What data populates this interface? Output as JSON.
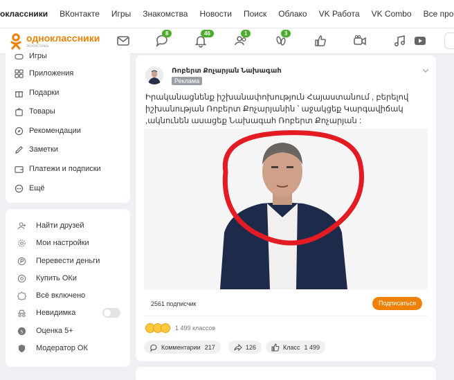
{
  "projects": {
    "items": [
      "оклассники",
      "ВКонтакте",
      "Игры",
      "Знакомства",
      "Новости",
      "Поиск",
      "Облако",
      "VK Работа",
      "VK Combo",
      "Все проекты"
    ]
  },
  "header": {
    "logo_text": "одноклассники",
    "logo_sub": "экосистема",
    "badges": {
      "discussions": "8",
      "notifications": "46",
      "friends": "1",
      "guests": "3"
    }
  },
  "sidebar": {
    "menu1": [
      "Игры",
      "Приложения",
      "Подарки",
      "Товары",
      "Рекомендации",
      "Заметки",
      "Платежи и подписки",
      "Ещё"
    ],
    "menu2": [
      "Найти друзей",
      "Мои настройки",
      "Перевести деньги",
      "Купить ОКи",
      "Всё включено",
      "Невидимка",
      "Оценка 5+",
      "Модератор ОК"
    ]
  },
  "post": {
    "author": "Ռոբերտ Քոչարյան Նախագահ",
    "ad_label": "Реклама",
    "text": "Իրականացնենք իշխանափոխություն Հայաստանում , բերելով իշխանության Ռոբերտ Քոչարյանին ՝ աջակցեք Կարգավիճակ ,ակնունեն ասացեք Նախագահ Ռոբերտ Քոչարյան :",
    "subscribers": "2561 подписчик",
    "subscribe_label": "Подписаться",
    "reactions_count": "1 499 классов",
    "comments_label": "Комментарии",
    "comments_count": "217",
    "shares_count": "126",
    "likes_label": "Класс",
    "likes_count": "1 499"
  },
  "colors": {
    "accent": "#ee8208",
    "badge": "#4cad2c"
  }
}
